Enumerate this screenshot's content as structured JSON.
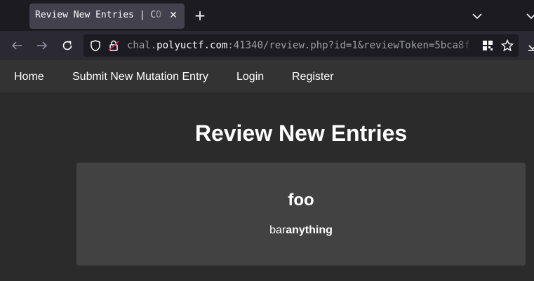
{
  "browser": {
    "tab_title": "Review New Entries | CO",
    "url_prefix": "chal.",
    "url_host": "polyuctf.com",
    "url_rest": ":41340/review.php?id=1&reviewToken=5bca8f"
  },
  "nav": {
    "home": "Home",
    "submit": "Submit New Mutation Entry",
    "login": "Login",
    "register": "Register"
  },
  "page": {
    "title": "Review New Entries"
  },
  "entry": {
    "title": "foo",
    "body_plain": "bar",
    "body_bold": "anything"
  },
  "colors": {
    "page_bg": "#2b2b2b",
    "nav_bg": "#333333",
    "card_bg": "#424242"
  }
}
